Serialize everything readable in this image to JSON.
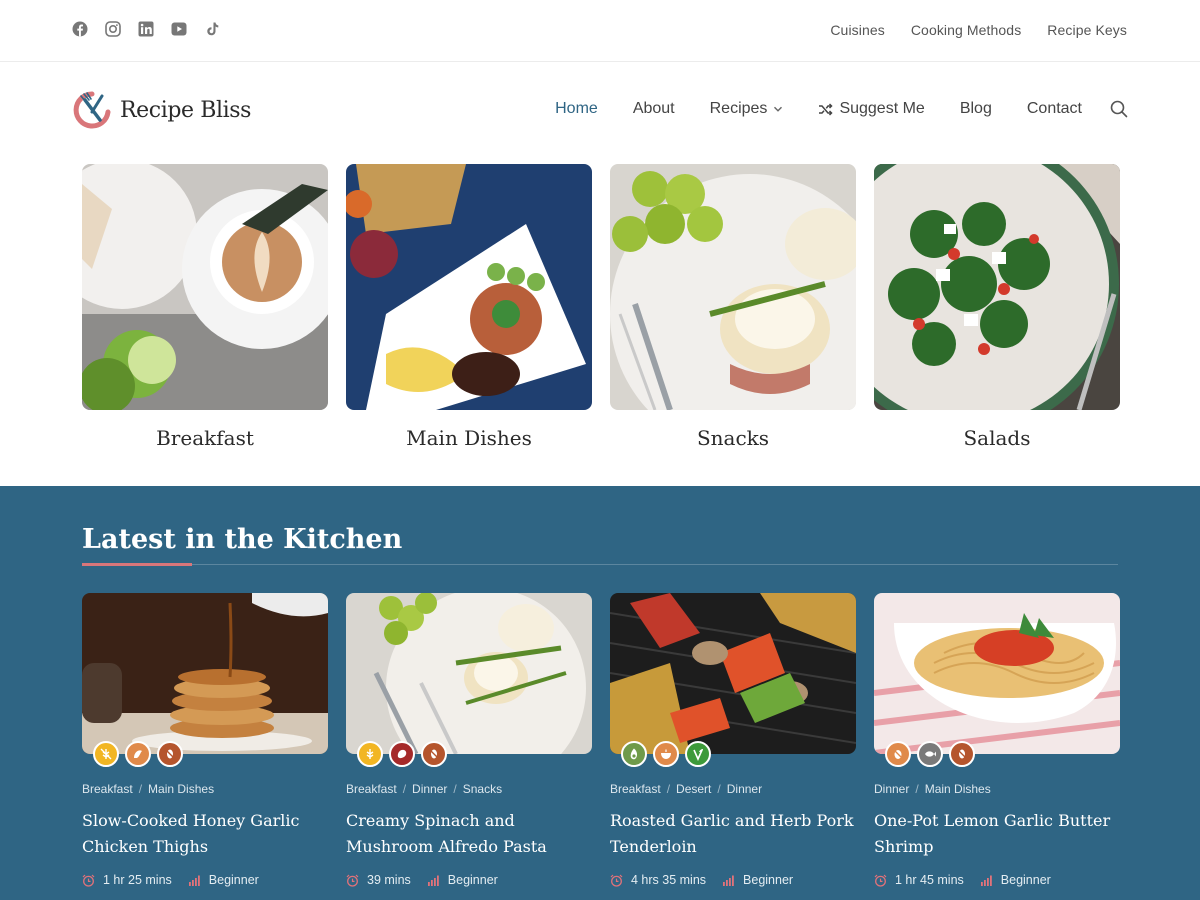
{
  "topbar": {
    "social_icons": [
      "facebook-icon",
      "instagram-icon",
      "linkedin-icon",
      "youtube-icon",
      "tiktok-icon"
    ],
    "links": [
      "Cuisines",
      "Cooking Methods",
      "Recipe Keys"
    ]
  },
  "header": {
    "logo_text": "Recipe Bliss",
    "nav": [
      "Home",
      "About",
      "Recipes",
      "Suggest Me",
      "Blog",
      "Contact"
    ],
    "active": "Home"
  },
  "categories": [
    {
      "name": "Breakfast",
      "image": "coffee-and-pastry"
    },
    {
      "name": "Main Dishes",
      "image": "rice-platter"
    },
    {
      "name": "Snacks",
      "image": "eggs-benedict"
    },
    {
      "name": "Salads",
      "image": "spinach-salad"
    }
  ],
  "latest": {
    "title": "Latest in the Kitchen",
    "cards": [
      {
        "crumbs": [
          "Breakfast",
          "Main Dishes"
        ],
        "title": "Slow-Cooked Honey Garlic Chicken Thighs",
        "time": "1 hr 25 mins",
        "level": "Beginner",
        "image": "pancakes-with-syrup"
      },
      {
        "crumbs": [
          "Breakfast",
          "Dinner",
          "Snacks"
        ],
        "title": "Creamy Spinach and Mushroom Alfredo Pasta",
        "time": "39 mins",
        "level": "Beginner",
        "image": "eggs-benedict"
      },
      {
        "crumbs": [
          "Breakfast",
          "Desert",
          "Dinner"
        ],
        "title": "Roasted Garlic and Herb Pork Tenderloin",
        "time": "4 hrs 35 mins",
        "level": "Beginner",
        "image": "grilled-vegetables"
      },
      {
        "crumbs": [
          "Dinner",
          "Main Dishes"
        ],
        "title": "One-Pot Lemon Garlic Butter Shrimp",
        "time": "1 hr 45 mins",
        "level": "Beginner",
        "image": "spaghetti-bowl"
      }
    ]
  },
  "colors": {
    "accent": "#2f6584",
    "pink": "#d9767a",
    "badge_yellow": "#f2b623",
    "badge_orange": "#e08a4a",
    "badge_rust": "#b5552d",
    "badge_red": "#a52a2a",
    "badge_green": "#6f9a4a",
    "badge_leaf": "#3d9a3a"
  }
}
